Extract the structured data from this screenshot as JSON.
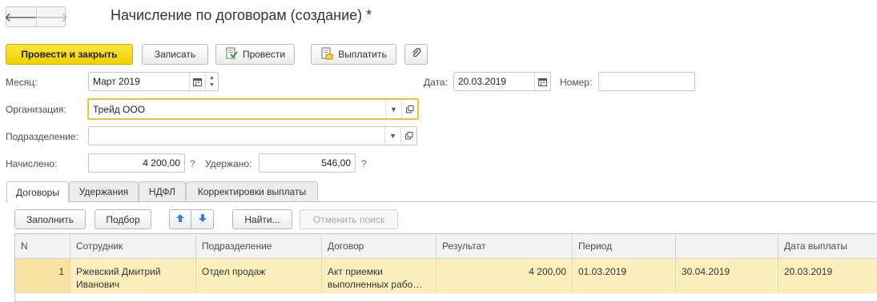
{
  "window": {
    "title": "Начисление по договорам (создание) *"
  },
  "nav": {
    "back": "🡐",
    "forward": "🡒"
  },
  "toolbar": {
    "post_and_close": "Провести и закрыть",
    "save": "Записать",
    "post": "Провести",
    "pay": "Выплатить"
  },
  "form": {
    "month_label": "Месяц:",
    "month_value": "Март 2019",
    "date_label": "Дата:",
    "date_value": "20.03.2019",
    "number_label": "Номер:",
    "number_value": "",
    "org_label": "Организация:",
    "org_value": "Трейд ООО",
    "dept_label": "Подразделение:",
    "dept_value": "",
    "accrued_label": "Начислено:",
    "accrued_value": "4 200,00",
    "withheld_label": "Удержано:",
    "withheld_value": "546,00",
    "help": "?"
  },
  "tabs": [
    "Договоры",
    "Удержания",
    "НДФЛ",
    "Корректировки выплаты"
  ],
  "table_toolbar": {
    "fill": "Заполнить",
    "select": "Подбор",
    "find": "Найти...",
    "cancel_search": "Отменить поиск"
  },
  "table": {
    "columns": [
      "N",
      "Сотрудник",
      "Подразделение",
      "Договор",
      "Результат",
      "Период",
      "",
      "Дата выплаты"
    ],
    "rows": [
      {
        "n": "1",
        "employee": "Ржевский Дмитрий Иванович",
        "department": "Отдел продаж",
        "contract": "Акт приемки выполненных рабо…",
        "result": "4 200,00",
        "period_start": "01.03.2019",
        "period_end": "30.04.2019",
        "payment_date": "20.03.2019"
      }
    ]
  },
  "colors": {
    "accent": "#f2d100",
    "selected_row": "#fbf0bd",
    "help": "#2a72c7",
    "focus": "#e5c43f"
  }
}
